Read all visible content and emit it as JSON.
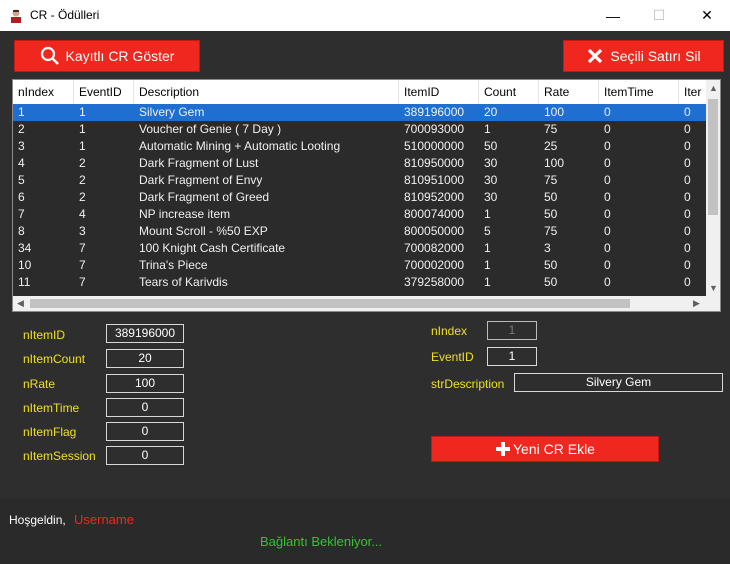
{
  "window": {
    "title": "CR - Ödülleri",
    "minimize_glyph": "—",
    "maximize_glyph": "☐",
    "close_glyph": "✕"
  },
  "toolbar": {
    "show_label": "Kayıtlı CR Göster",
    "delete_label": "Seçili Satırı Sil"
  },
  "grid": {
    "columns": [
      "nIndex",
      "EventID",
      "Description",
      "ItemID",
      "Count",
      "Rate",
      "ItemTime",
      "Iter"
    ],
    "rows": [
      [
        "1",
        "1",
        "Silvery Gem",
        "389196000",
        "20",
        "100",
        "0",
        "0"
      ],
      [
        "2",
        "1",
        "Voucher of Genie ( 7 Day )",
        "700093000",
        "1",
        "75",
        "0",
        "0"
      ],
      [
        "3",
        "1",
        "Automatic Mining + Automatic Looting",
        "510000000",
        "50",
        "25",
        "0",
        "0"
      ],
      [
        "4",
        "2",
        "Dark Fragment of Lust",
        "810950000",
        "30",
        "100",
        "0",
        "0"
      ],
      [
        "5",
        "2",
        "Dark Fragment of Envy",
        "810951000",
        "30",
        "75",
        "0",
        "0"
      ],
      [
        "6",
        "2",
        "Dark Fragment of Greed",
        "810952000",
        "30",
        "50",
        "0",
        "0"
      ],
      [
        "7",
        "4",
        "NP increase item",
        "800074000",
        "1",
        "50",
        "0",
        "0"
      ],
      [
        "8",
        "3",
        "Mount Scroll - %50 EXP",
        "800050000",
        "5",
        "75",
        "0",
        "0"
      ],
      [
        "34",
        "7",
        "100 Knight Cash Certificate",
        "700082000",
        "1",
        "3",
        "0",
        "0"
      ],
      [
        "10",
        "7",
        "Trina's Piece",
        "700002000",
        "1",
        "50",
        "0",
        "0"
      ],
      [
        "11",
        "7",
        "Tears of Karivdis",
        "379258000",
        "1",
        "50",
        "0",
        "0"
      ]
    ],
    "selected_row": 0
  },
  "form": {
    "nItemID": {
      "label": "nItemID",
      "value": "389196000"
    },
    "nItemCount": {
      "label": "nItemCount",
      "value": "20"
    },
    "nRate": {
      "label": "nRate",
      "value": "100"
    },
    "nItemTime": {
      "label": "nItemTime",
      "value": "0"
    },
    "nItemFlag": {
      "label": "nItemFlag",
      "value": "0"
    },
    "nItemSession": {
      "label": "nItemSession",
      "value": "0"
    },
    "nIndex": {
      "label": "nIndex",
      "value": "1"
    },
    "EventID": {
      "label": "EventID",
      "value": "1"
    },
    "strDescription": {
      "label": "strDescription",
      "value": "Silvery Gem"
    },
    "add_label": "Yeni CR Ekle"
  },
  "status": {
    "welcome": "Hoşgeldin,",
    "username": "Username",
    "connection": "Bağlantı Bekleniyor..."
  },
  "colors": {
    "accent_red": "#f0271f",
    "selection_blue": "#1e6fcf",
    "label_yellow": "#f0e020",
    "status_green": "#38c038",
    "background": "#2e2e2e"
  }
}
